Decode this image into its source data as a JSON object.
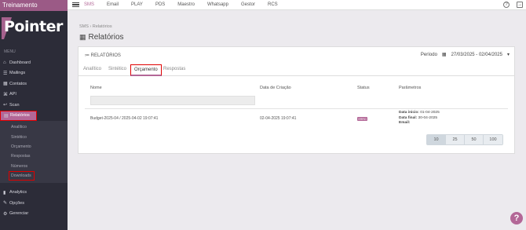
{
  "brand": {
    "title": "Treinamento",
    "logo_text": "Pointer"
  },
  "menu_label": "MENU",
  "sidebar": {
    "items": [
      {
        "label": "Dashboard",
        "icon": "home-icon"
      },
      {
        "label": "Mailings",
        "icon": "list-icon"
      },
      {
        "label": "Contatos",
        "icon": "contacts-icon"
      },
      {
        "label": "API",
        "icon": "api-icon"
      },
      {
        "label": "Scan",
        "icon": "scan-icon"
      },
      {
        "label": "Relatórios",
        "icon": "report-icon"
      }
    ],
    "subitems": [
      "Analítico",
      "Sintético",
      "Orçamento",
      "Respostas",
      "Números",
      "Downloads"
    ],
    "bottom": [
      {
        "label": "Analytics",
        "icon": "bar-chart-icon"
      },
      {
        "label": "Opções",
        "icon": "wrench-icon"
      },
      {
        "label": "Gerenciar",
        "icon": "gear-icon"
      }
    ]
  },
  "topbar": {
    "tabs": [
      "SMS",
      "Email",
      "PLAY",
      "PDS",
      "Maestro",
      "Whatsapp",
      "Gestor",
      "RCS"
    ],
    "active": "SMS"
  },
  "breadcrumb": "SMS  ›  Relatórios",
  "page_title": "Relatórios",
  "card": {
    "label": "RELATÓRIOS",
    "periodo_label": "Período",
    "periodo_value": "27/03/2025 - 02/04/2025",
    "tabs": [
      "Analítico",
      "Sintético",
      "Orçamento",
      "Respostas"
    ],
    "active_tab": "Orçamento"
  },
  "table": {
    "headers": [
      "Nome",
      "Data de Criação",
      "Status",
      "Parâmetros"
    ],
    "rows": [
      {
        "nome": "Budget-2025-04 / 2025-04-02 19:07:41",
        "data": "02-04-2025 19:07:41",
        "status": "ERRO",
        "param_inicio_label": "Data inicio:",
        "param_inicio": "01-04-2025",
        "param_final_label": "Data final:",
        "param_final": "30-04-2025",
        "param_email_label": "Email:"
      }
    ]
  },
  "pager": [
    "10",
    "25",
    "50",
    "100"
  ],
  "help": "?"
}
